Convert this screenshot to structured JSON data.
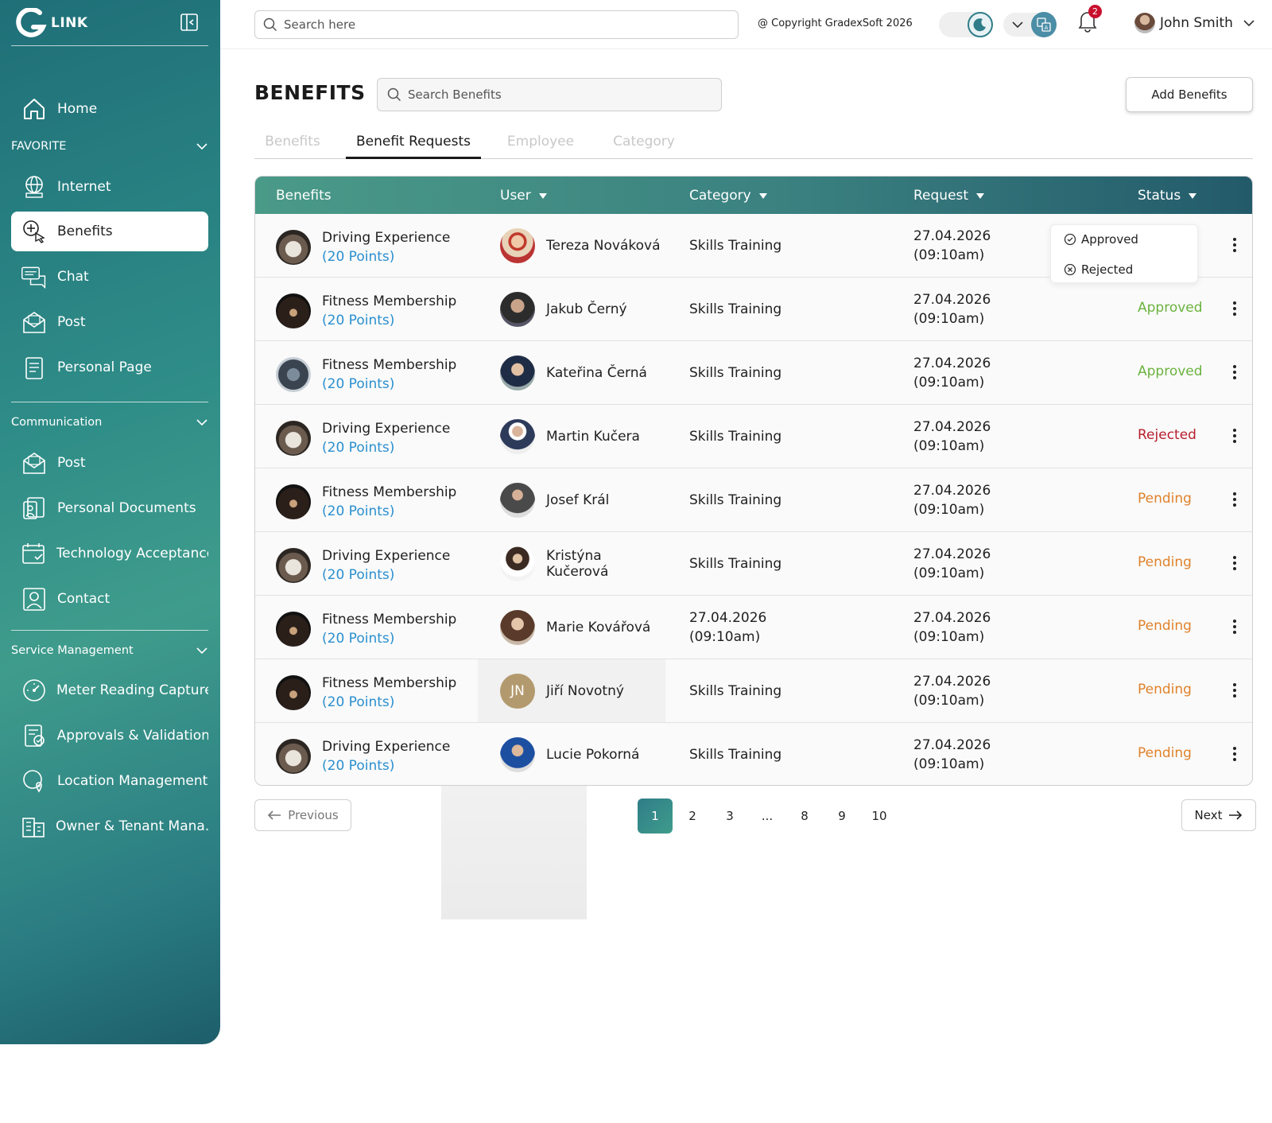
{
  "brand": {
    "logo_text": "LINK"
  },
  "sidebar": {
    "home": "Home",
    "favorite_section": "FAVORITE",
    "favorite_items": [
      "Internet",
      "Benefits",
      "Chat",
      "Post",
      "Personal Page"
    ],
    "communication_section": "Communication",
    "communication_items": [
      "Post",
      "Personal Documents",
      "Technology Acceptance",
      "Contact"
    ],
    "service_section": "Service Management",
    "service_items": [
      "Meter Reading Capture",
      "Approvals & Validation",
      "Location Management",
      "Owner & Tenant Mana..."
    ]
  },
  "topbar": {
    "search_placeholder": "Search here",
    "copyright": "@ Copyright GradexSoft 2026",
    "notification_count": "2",
    "user_name": "John Smith"
  },
  "page": {
    "title": "BENEFITS",
    "search_placeholder": "Search Benefits",
    "add_button": "Add Benefits"
  },
  "tabs": [
    "Benefits",
    "Benefit Requests",
    "Employee",
    "Category"
  ],
  "table": {
    "headers": [
      "Benefits",
      "User",
      "Category",
      "Request",
      "Status"
    ],
    "dropdown_options": [
      "Approved",
      "Rejected"
    ],
    "rows": [
      {
        "benefit": "Driving Experience",
        "points": "(20 Points)",
        "user": "Tereza Nováková",
        "category": "Skills Training",
        "request_date": "27.04.2026",
        "request_time": "(09:10am)",
        "status": ""
      },
      {
        "benefit": "Fitness Membership",
        "points": "(20 Points)",
        "user": "Jakub Černý",
        "category": "Skills Training",
        "request_date": "27.04.2026",
        "request_time": "(09:10am)",
        "status": "Approved"
      },
      {
        "benefit": "Fitness Membership",
        "points": "(20 Points)",
        "user": "Kateřina Černá",
        "category": "Skills Training",
        "request_date": "27.04.2026",
        "request_time": "(09:10am)",
        "status": "Approved"
      },
      {
        "benefit": "Driving Experience",
        "points": "(20 Points)",
        "user": "Martin Kučera",
        "category": "Skills Training",
        "request_date": "27.04.2026",
        "request_time": "(09:10am)",
        "status": "Rejected"
      },
      {
        "benefit": "Fitness Membership",
        "points": "(20 Points)",
        "user": "Josef Král",
        "category": "Skills Training",
        "request_date": "27.04.2026",
        "request_time": "(09:10am)",
        "status": "Pending"
      },
      {
        "benefit": "Driving Experience",
        "points": "(20 Points)",
        "user": "Kristýna Kučerová",
        "category": "Skills Training",
        "request_date": "27.04.2026",
        "request_time": "(09:10am)",
        "status": "Pending"
      },
      {
        "benefit": "Fitness Membership",
        "points": "(20 Points)",
        "user": "Marie Kovářová",
        "category": "27.04.2026",
        "category_time": "(09:10am)",
        "request_date": "27.04.2026",
        "request_time": "(09:10am)",
        "status": "Pending"
      },
      {
        "benefit": "Fitness Membership",
        "points": "(20 Points)",
        "user": "Jiří Novotný",
        "user_initials": "JN",
        "category": "Skills Training",
        "request_date": "27.04.2026",
        "request_time": "(09:10am)",
        "status": "Pending"
      },
      {
        "benefit": "Driving Experience",
        "points": "(20 Points)",
        "user": "Lucie Pokorná",
        "category": "Skills Training",
        "request_date": "27.04.2026",
        "request_time": "(09:10am)",
        "status": "Pending"
      }
    ]
  },
  "pagination": {
    "previous": "Previous",
    "next": "Next",
    "pages": [
      "1",
      "2",
      "3",
      "...",
      "8",
      "9",
      "10"
    ],
    "current": "1"
  },
  "colors": {
    "accent": "#2f7d88",
    "approved": "#6bb33f",
    "rejected": "#b81e2d",
    "pending": "#e0822b",
    "points": "#2a8fcf"
  }
}
